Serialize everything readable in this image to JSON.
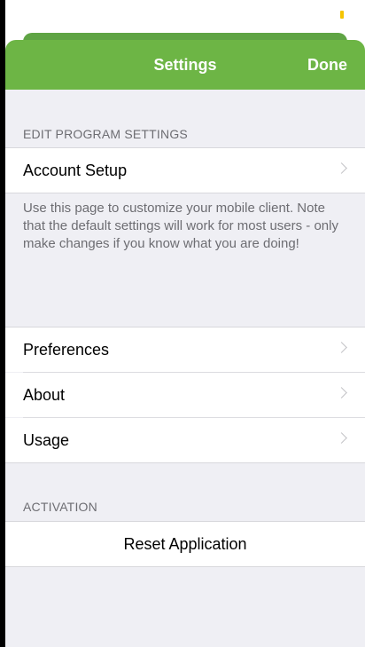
{
  "nav": {
    "title": "Settings",
    "done_label": "Done"
  },
  "sections": {
    "edit": {
      "header": "EDIT PROGRAM SETTINGS",
      "account_setup": "Account Setup",
      "footer": "Use this page to customize your mobile client. Note that the default settings will work for most users - only make changes if you know what you are doing!"
    },
    "general": {
      "preferences": "Preferences",
      "about": "About",
      "usage": "Usage"
    },
    "activation": {
      "header": "ACTIVATION",
      "reset": "Reset Application"
    }
  },
  "colors": {
    "brand_green": "#6db545",
    "status_indicator": "#f5c400"
  },
  "icons": [
    "chevron-right-icon"
  ]
}
